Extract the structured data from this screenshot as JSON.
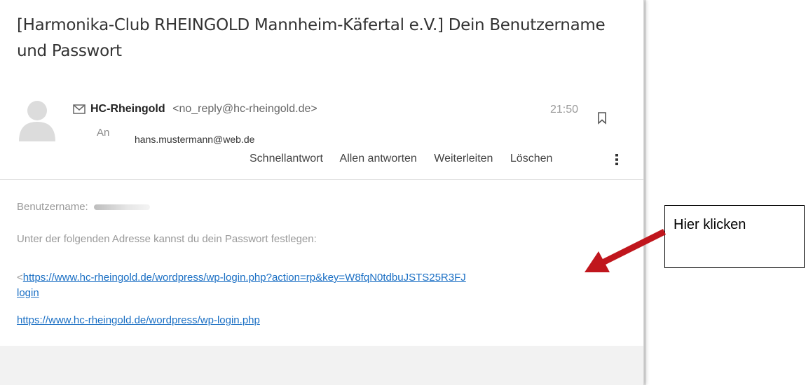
{
  "email": {
    "subject": "[Harmonika-Club RHEINGOLD Mannheim-Käfertal e.V.] Dein Benutzername und Passwort",
    "sender_name": "HC-Rheingold",
    "sender_email": "<no_reply@hc-rheingold.de>",
    "time": "21:50",
    "to_label": "An",
    "recipient": "hans.mustermann@web.de",
    "actions": [
      "Schnellantwort",
      "Allen antworten",
      "Weiterleiten",
      "Löschen"
    ],
    "body": {
      "username_label": "Benutzername:",
      "instruction": "Unter der folgenden Adresse kannst du dein Passwort festlegen:",
      "reset_prefix": "<",
      "reset_link_line1": "https://www.hc-rheingold.de/wordpress/wp-login.php?action=rp&key=W8fqN0tdbuJSTS25R3FJ",
      "reset_link_line2": "login",
      "login_link": "https://www.hc-rheingold.de/wordpress/wp-login.php"
    }
  },
  "annotation": {
    "callout_text": "Hier klicken",
    "arrow_color": "#c0161d"
  },
  "icons": [
    "avatar-placeholder",
    "envelope-icon",
    "bookmark-icon",
    "more-vertical-icon"
  ]
}
